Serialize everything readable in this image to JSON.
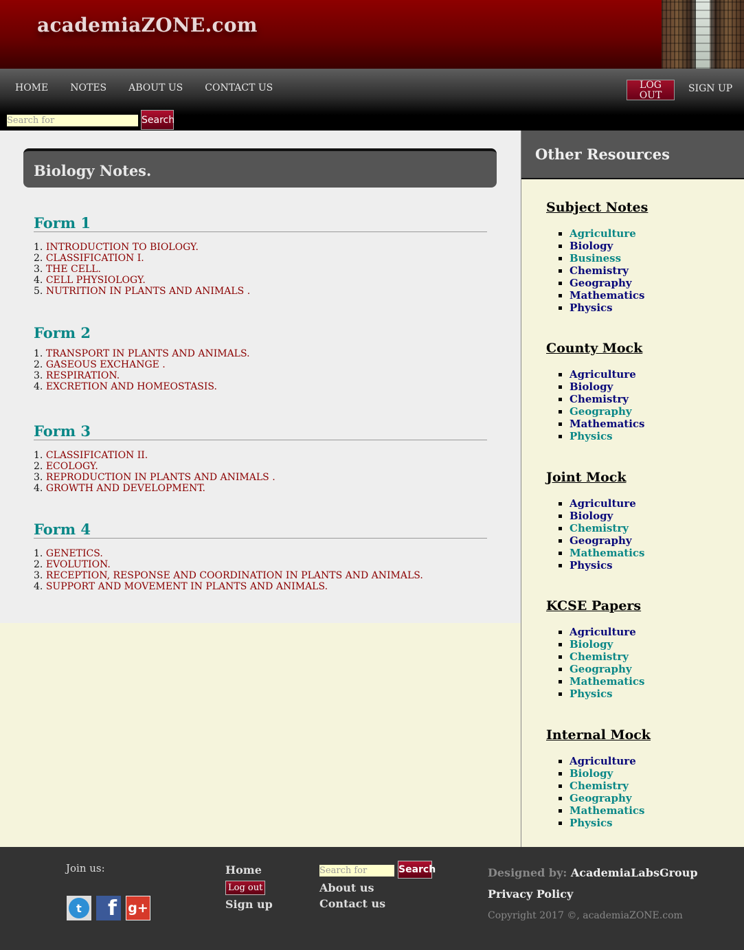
{
  "header": {
    "site_title": "academiaZONE.com"
  },
  "nav": {
    "links": [
      "HOME",
      "NOTES",
      "ABOUT US",
      "CONTACT US"
    ],
    "logout_label": "LOG OUT",
    "signup_label": "SIGN UP",
    "search_placeholder": "Search for",
    "search_button": "Search"
  },
  "main": {
    "heading": "Biology Notes.",
    "forms": [
      {
        "title": "Form 1",
        "topics": [
          "INTRODUCTION TO BIOLOGY.",
          "CLASSIFICATION I.",
          "THE CELL.",
          "CELL PHYSIOLOGY.",
          "NUTRITION IN PLANTS AND ANIMALS ."
        ]
      },
      {
        "title": "Form 2",
        "topics": [
          "TRANSPORT IN PLANTS AND ANIMALS.",
          "GASEOUS EXCHANGE .",
          "RESPIRATION.",
          "EXCRETION AND HOMEOSTASIS."
        ]
      },
      {
        "title": "Form 3",
        "topics": [
          "CLASSIFICATION II.",
          "ECOLOGY.",
          "REPRODUCTION IN PLANTS AND ANIMALS .",
          "GROWTH AND DEVELOPMENT."
        ]
      },
      {
        "title": "Form 4",
        "topics": [
          "GENETICS.",
          "EVOLUTION.",
          "RECEPTION, RESPONSE AND COORDINATION IN PLANTS AND ANIMALS.",
          "SUPPORT AND MOVEMENT IN PLANTS AND ANIMALS."
        ]
      }
    ]
  },
  "sidebar": {
    "title": "Other Resources",
    "groups": [
      {
        "heading": "Subject Notes",
        "items": [
          "Agriculture",
          "Biology",
          "Business",
          "Chemistry",
          "Geography",
          "Mathematics",
          "Physics"
        ],
        "colors": [
          "teal",
          "navy",
          "teal",
          "navy",
          "navy",
          "navy",
          "navy"
        ]
      },
      {
        "heading": "County Mock",
        "items": [
          "Agriculture",
          "Biology",
          "Chemistry",
          "Geography",
          "Mathematics",
          "Physics"
        ],
        "colors": [
          "navy",
          "navy",
          "navy",
          "teal",
          "navy",
          "teal"
        ]
      },
      {
        "heading": "Joint Mock",
        "items": [
          "Agriculture",
          "Biology",
          "Chemistry",
          "Geography",
          "Mathematics",
          "Physics"
        ],
        "colors": [
          "navy",
          "navy",
          "teal",
          "navy",
          "teal",
          "navy"
        ]
      },
      {
        "heading": "KCSE Papers",
        "items": [
          "Agriculture",
          "Biology",
          "Chemistry",
          "Geography",
          "Mathematics",
          "Physics"
        ],
        "colors": [
          "navy",
          "teal",
          "teal",
          "teal",
          "teal",
          "teal"
        ]
      },
      {
        "heading": "Internal Mock",
        "items": [
          "Agriculture",
          "Biology",
          "Chemistry",
          "Geography",
          "Mathematics",
          "Physics"
        ],
        "colors": [
          "navy",
          "teal",
          "teal",
          "teal",
          "teal",
          "teal"
        ]
      }
    ]
  },
  "footer": {
    "join_label": "Join us:",
    "social_icons": [
      "twitter-icon",
      "facebook-icon",
      "google-plus-icon"
    ],
    "home": "Home",
    "logout": "Log out",
    "signup": "Sign up",
    "search_placeholder": "Search for",
    "search_button": "Search",
    "about": "About us",
    "contact": "Contact us",
    "designed_by_label": "Designed by:",
    "designed_by": "AcademiaLabsGroup",
    "privacy": "Privacy Policy",
    "copyright": "Copyright 2017 ©, academiaZONE.com"
  },
  "colors": {
    "banner": "#8e0000",
    "teal": "#0a8787",
    "navy": "#0a0a7a",
    "topic_link": "#8b0000",
    "sidebar_bg": "#f5f4dc",
    "footer_bg": "#333333"
  }
}
